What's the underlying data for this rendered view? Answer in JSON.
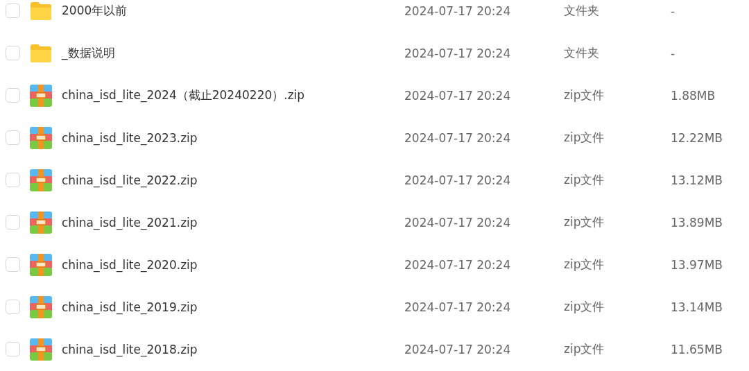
{
  "files": [
    {
      "kind": "folder",
      "checked": false,
      "name": "2000年以前",
      "modified": "2024-07-17 20:24",
      "type": "文件夹",
      "size": "-"
    },
    {
      "kind": "folder",
      "checked": false,
      "name": "_数据说明",
      "modified": "2024-07-17 20:24",
      "type": "文件夹",
      "size": "-"
    },
    {
      "kind": "zip",
      "checked": false,
      "name": "china_isd_lite_2024（截止20240220）.zip",
      "modified": "2024-07-17 20:24",
      "type": "zip文件",
      "size": "1.88MB"
    },
    {
      "kind": "zip",
      "checked": false,
      "name": "china_isd_lite_2023.zip",
      "modified": "2024-07-17 20:24",
      "type": "zip文件",
      "size": "12.22MB"
    },
    {
      "kind": "zip",
      "checked": false,
      "name": "china_isd_lite_2022.zip",
      "modified": "2024-07-17 20:24",
      "type": "zip文件",
      "size": "13.12MB"
    },
    {
      "kind": "zip",
      "checked": false,
      "name": "china_isd_lite_2021.zip",
      "modified": "2024-07-17 20:24",
      "type": "zip文件",
      "size": "13.89MB"
    },
    {
      "kind": "zip",
      "checked": false,
      "name": "china_isd_lite_2020.zip",
      "modified": "2024-07-17 20:24",
      "type": "zip文件",
      "size": "13.97MB"
    },
    {
      "kind": "zip",
      "checked": false,
      "name": "china_isd_lite_2019.zip",
      "modified": "2024-07-17 20:24",
      "type": "zip文件",
      "size": "13.14MB"
    },
    {
      "kind": "zip",
      "checked": false,
      "name": "china_isd_lite_2018.zip",
      "modified": "2024-07-17 20:24",
      "type": "zip文件",
      "size": "11.65MB"
    }
  ]
}
